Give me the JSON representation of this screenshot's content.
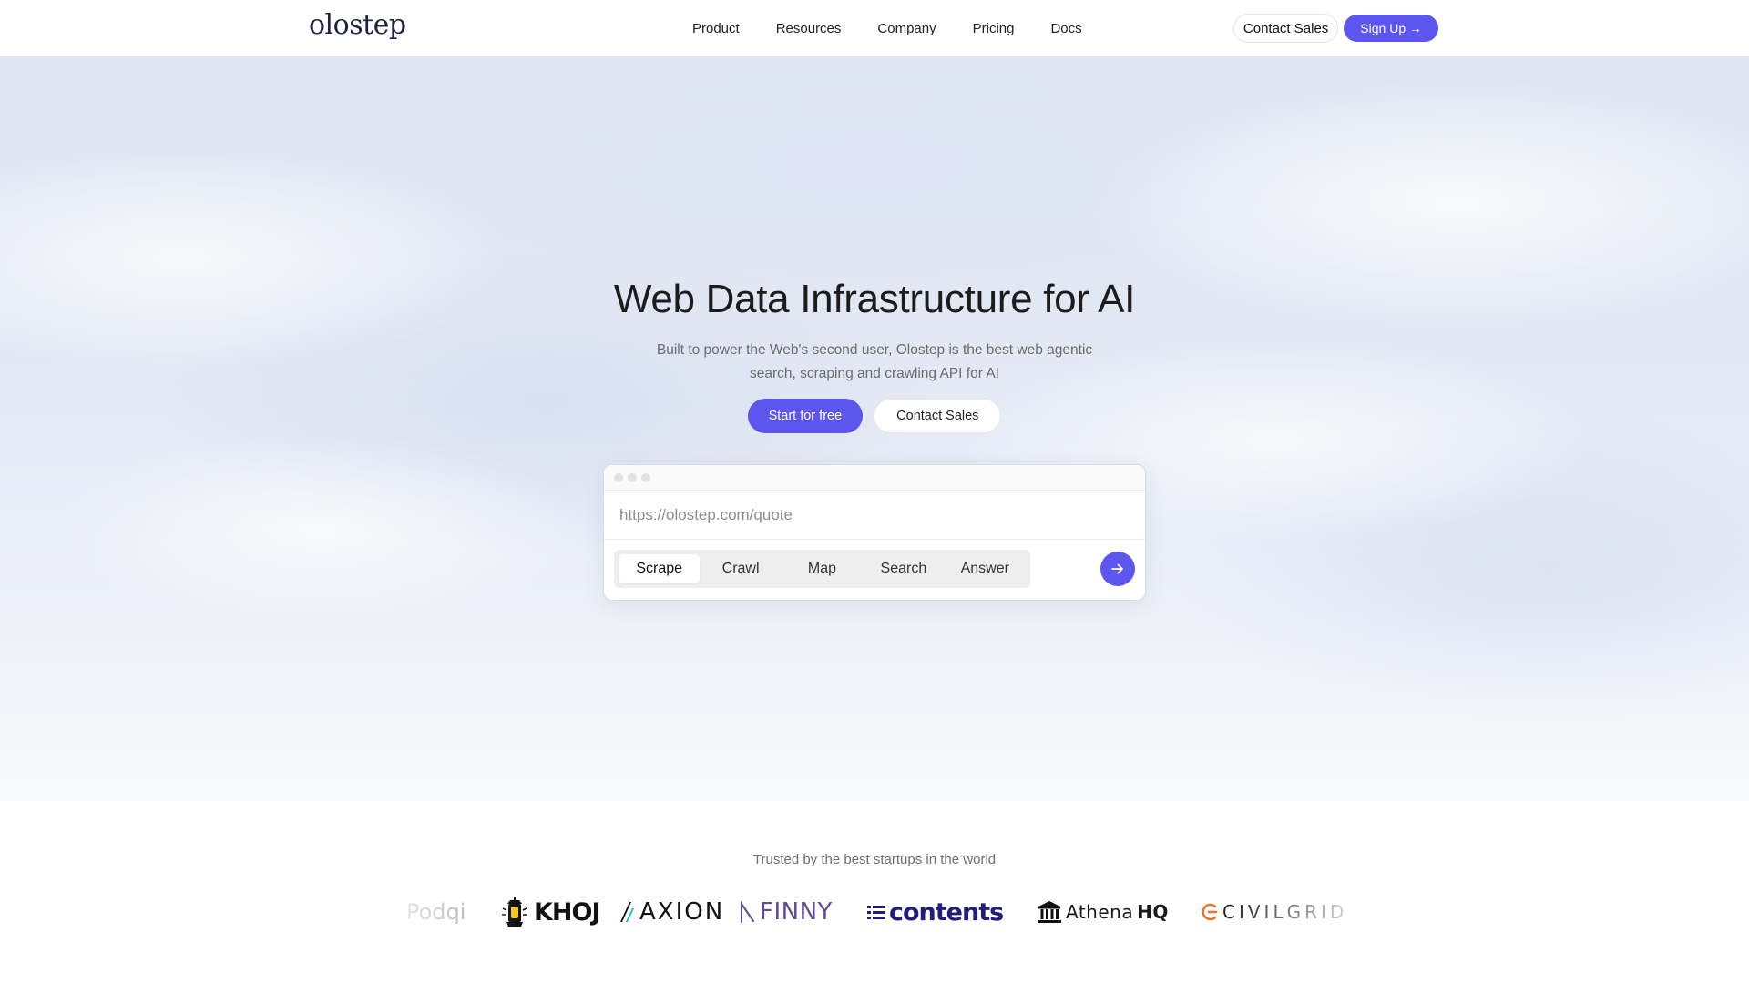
{
  "header": {
    "logo": "olostep",
    "nav": [
      "Product",
      "Resources",
      "Company",
      "Pricing",
      "Docs"
    ],
    "contact_sales": "Contact Sales",
    "sign_up": "Sign Up →"
  },
  "hero": {
    "title": "Web Data Infrastructure for AI",
    "subtitle": "Built to power the Web's second user, Olostep is the best web agentic search, scraping and crawling API for AI",
    "primary_cta": "Start for free",
    "secondary_cta": "Contact Sales"
  },
  "demo": {
    "url_placeholder": "https://olostep.com/quote",
    "modes": [
      "Scrape",
      "Crawl",
      "Map",
      "Search",
      "Answer"
    ],
    "active_mode": "Scrape"
  },
  "trusted": {
    "heading": "Trusted by the best startups in the world",
    "logos": [
      "Podqi",
      "KHOJ",
      "AXION",
      "FINNY",
      "contents",
      "Athena",
      "HQ",
      "CIVILGRID"
    ]
  },
  "colors": {
    "accent": "#5c55ee",
    "text": "#1c1c1c",
    "muted": "#6b6b6b"
  }
}
